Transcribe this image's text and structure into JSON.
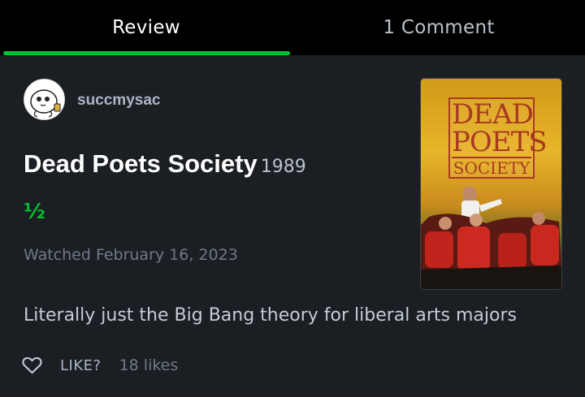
{
  "tabs": [
    {
      "label": "Review",
      "active": true
    },
    {
      "label": "1 Comment",
      "active": false
    }
  ],
  "accent_color": "#00c030",
  "review": {
    "username": "succmysac",
    "film_title": "Dead Poets Society",
    "film_year": "1989",
    "rating": "½",
    "watched": "Watched February 16, 2023",
    "text": "Literally just the Big Bang theory for liberal arts majors"
  },
  "poster": {
    "title_line1": "DEAD",
    "title_line2": "POETS",
    "title_line3": "SOCIETY"
  },
  "likes": {
    "like_label": "LIKE?",
    "count_label": "18 likes",
    "icon": "heart-outline-icon"
  }
}
